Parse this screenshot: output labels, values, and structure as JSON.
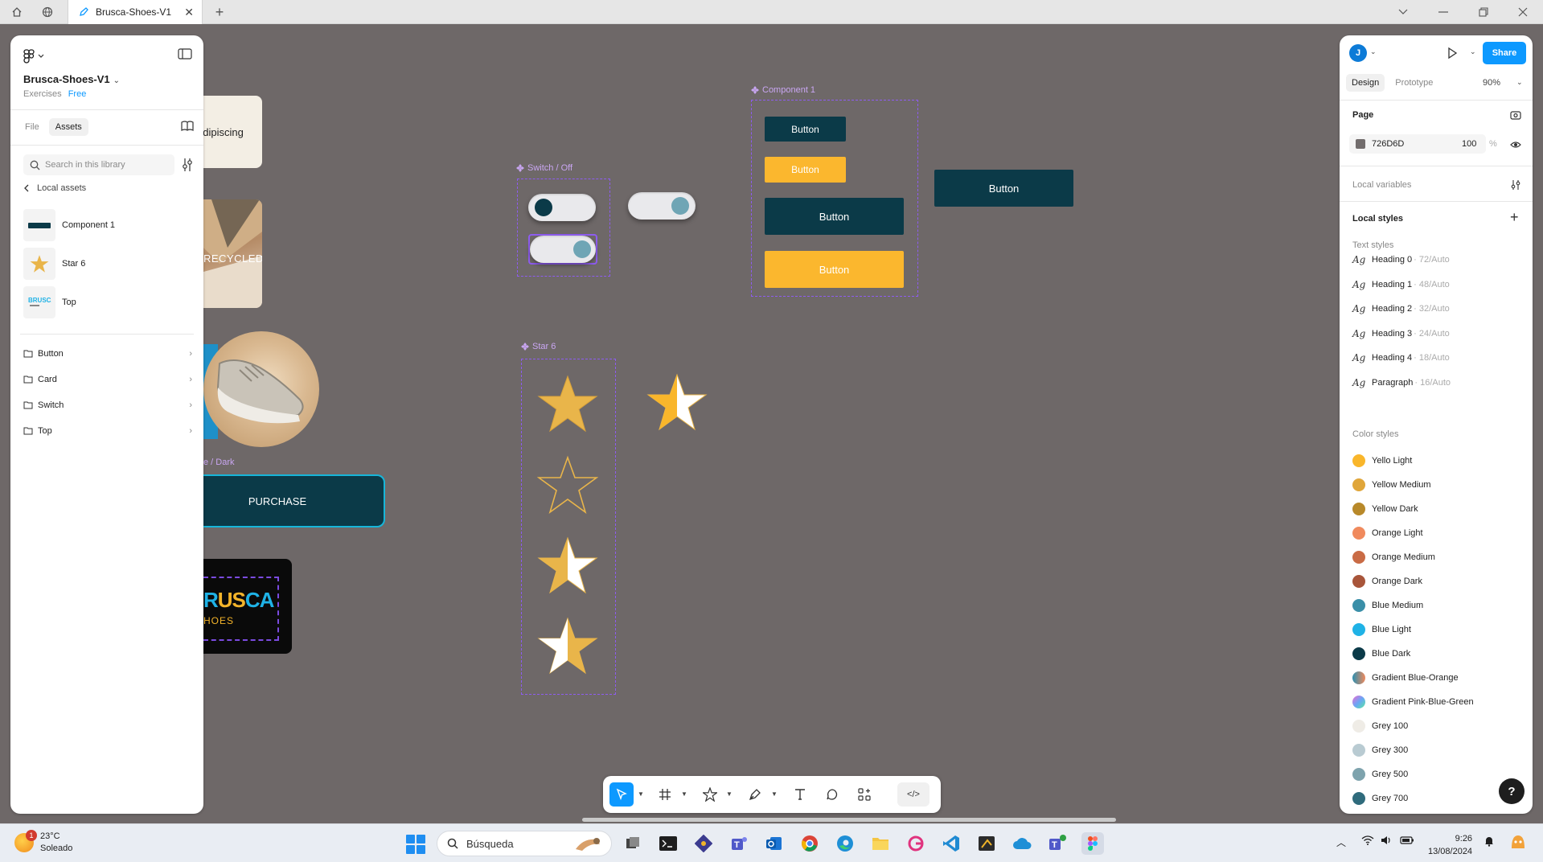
{
  "browser": {
    "tab_title": "Brusca-Shoes-V1",
    "new_tab_symbol": "+"
  },
  "left_panel": {
    "file_name": "Brusca-Shoes-V1",
    "project": "Exercises",
    "plan": "Free",
    "tabs": [
      "File",
      "Assets"
    ],
    "active_tab": "Assets",
    "search_placeholder": "Search in this library",
    "back_label": "Local assets",
    "assets": [
      {
        "label": "Component 1",
        "icon": "button-thumbnail"
      },
      {
        "label": "Star 6",
        "icon": "star-thumbnail"
      },
      {
        "label": "Top",
        "icon": "logo-thumbnail"
      }
    ],
    "folders": [
      "Button",
      "Card",
      "Switch",
      "Top"
    ]
  },
  "right_panel": {
    "avatar_initial": "J",
    "share_label": "Share",
    "tabs": [
      "Design",
      "Prototype"
    ],
    "active_tab": "Design",
    "zoom": "90%",
    "page_section": "Page",
    "page_color": "726D6D",
    "page_opacity": "100",
    "page_opacity_unit": "%",
    "local_variables": "Local variables",
    "local_styles": "Local styles",
    "text_styles_label": "Text styles",
    "text_styles": [
      {
        "name": "Heading 0",
        "meta": "· 72/Auto"
      },
      {
        "name": "Heading 1",
        "meta": "· 48/Auto"
      },
      {
        "name": "Heading 2",
        "meta": "· 32/Auto"
      },
      {
        "name": "Heading 3",
        "meta": "· 24/Auto"
      },
      {
        "name": "Heading 4",
        "meta": "· 18/Auto"
      },
      {
        "name": "Paragraph",
        "meta": "· 16/Auto"
      }
    ],
    "text_style_glyph": "Ag",
    "color_styles_label": "Color styles",
    "color_styles": [
      {
        "name": "Yello Light",
        "color": "#f9b62b"
      },
      {
        "name": "Yellow Medium",
        "color": "#e0a63a"
      },
      {
        "name": "Yellow Dark",
        "color": "#b8892a"
      },
      {
        "name": "Orange Light",
        "color": "#f08a5d"
      },
      {
        "name": "Orange Medium",
        "color": "#c96b45"
      },
      {
        "name": "Orange Dark",
        "color": "#a8553a"
      },
      {
        "name": "Blue Medium",
        "color": "#3a8fa8"
      },
      {
        "name": "Blue Light",
        "color": "#1fb2e6"
      },
      {
        "name": "Blue Dark",
        "color": "#0b3a48"
      },
      {
        "name": "Gradient Blue-Orange",
        "color": "linear-gradient(90deg,#2c8fb0,#f08a5d)"
      },
      {
        "name": "Gradient Pink-Blue-Green",
        "color": "linear-gradient(135deg,#f06bd4,#6aa6f5,#5ae8a0)"
      },
      {
        "name": "Grey 100",
        "color": "#efece6"
      },
      {
        "name": "Grey 300",
        "color": "#b9cbd2"
      },
      {
        "name": "Grey 500",
        "color": "#7ea3ad"
      },
      {
        "name": "Grey 700",
        "color": "#2f6b7c"
      }
    ],
    "help_label": "?"
  },
  "canvas": {
    "page_color": "#726d6d",
    "card_text": "adipiscing",
    "recycled_text": "RECYCLED",
    "purchase_caption": "e / Dark",
    "purchase_label": "PURCHASE",
    "logo_text_a": "R",
    "logo_text_b": "US",
    "logo_text_c": "CA",
    "logo_sub": "HOES",
    "switch_frame_label": "Switch / Off",
    "component_frame_label": "Component 1",
    "star_frame_label": "Star 6",
    "button_label": "Button",
    "colors": {
      "dark": "#0b3a48",
      "yellow": "#fbb72e",
      "star": "#e9b54a"
    }
  },
  "toolbar": {
    "tools": [
      "move-icon",
      "frame-icon",
      "shape-icon",
      "pen-icon",
      "text-icon",
      "comment-icon",
      "actions-icon",
      "dev-mode-icon"
    ],
    "dev_label": "</>"
  },
  "taskbar": {
    "weather_temp": "23°C",
    "weather_text": "Soleado",
    "weather_badge": "1",
    "search_label": "Búsqueda",
    "time": "9:26",
    "date": "13/08/2024"
  }
}
